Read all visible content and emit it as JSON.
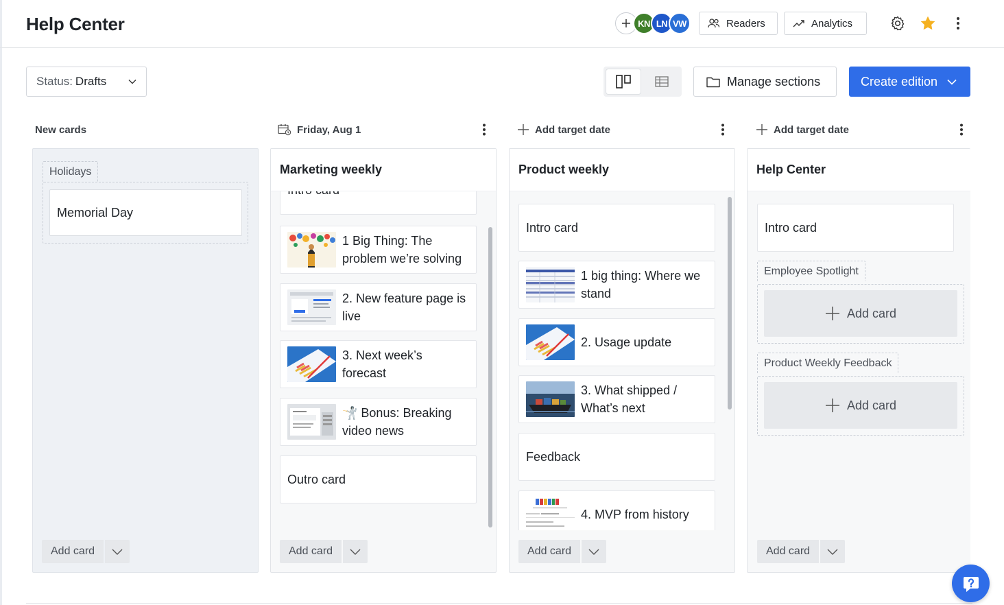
{
  "header": {
    "title": "Help Center",
    "avatars": [
      {
        "initials": "KN",
        "color": "#3f7f2a"
      },
      {
        "initials": "LN",
        "color": "#1f57c9"
      },
      {
        "initials": "VW",
        "color": "#2a6fd6"
      }
    ],
    "readers_label": "Readers",
    "analytics_label": "Analytics",
    "star_color": "#f5b120"
  },
  "toolbar": {
    "status_key": "Status:",
    "status_value": "Drafts",
    "manage_sections_label": "Manage sections",
    "create_edition_label": "Create edition",
    "accent": "#2f6de8"
  },
  "columns": [
    {
      "header": "New cards",
      "sections": [
        {
          "name": "Holidays",
          "cards": [
            "Memorial Day"
          ]
        }
      ],
      "add_card_label": "Add card"
    },
    {
      "header": "Friday, Aug 1",
      "title": "Marketing weekly",
      "cards": [
        "Intro card",
        "1 Big Thing: The problem we’re solving",
        "2. New feature page is live",
        "3. Next week’s forecast",
        "🤺 Bonus: Breaking video news",
        "Outro card"
      ],
      "add_card_label": "Add card"
    },
    {
      "header": "Add target date",
      "title": "Product weekly",
      "cards": [
        "Intro card",
        "1 big thing: Where we stand",
        "2. Usage update",
        "3. What shipped / What’s next",
        "Feedback",
        "4. MVP from history"
      ],
      "add_card_label": "Add card"
    },
    {
      "header": "Add target date",
      "title": "Help Center",
      "cards": [
        "Intro card"
      ],
      "sections": [
        {
          "name": "Employee Spotlight",
          "add_label": "Add card"
        },
        {
          "name": "Product Weekly Feedback",
          "add_label": "Add card"
        }
      ],
      "add_card_label": "Add card"
    }
  ]
}
